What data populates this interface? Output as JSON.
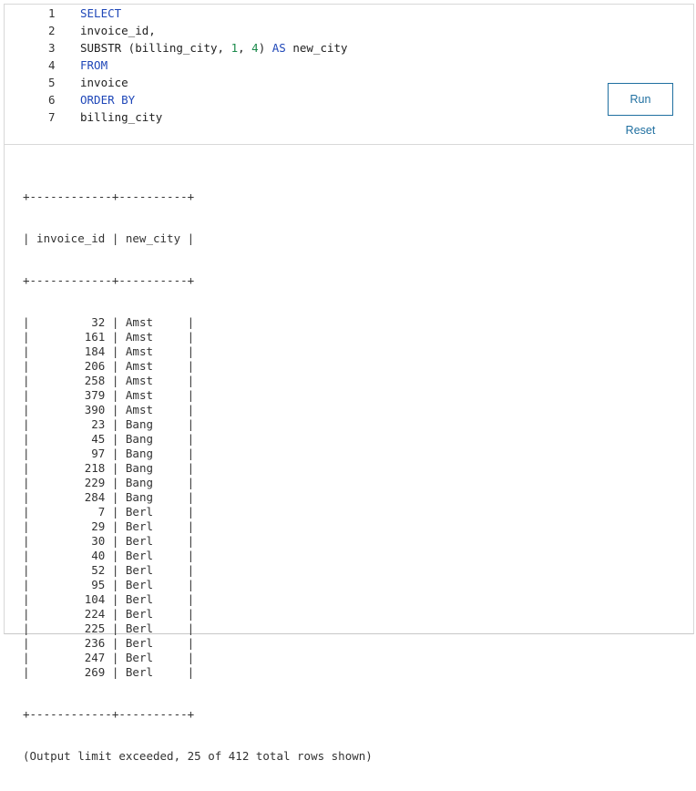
{
  "editor": {
    "lines": [
      {
        "num": "1",
        "parts": [
          {
            "t": "SELECT",
            "c": "kw"
          }
        ]
      },
      {
        "num": "2",
        "parts": [
          {
            "t": "invoice_id,",
            "c": ""
          }
        ]
      },
      {
        "num": "3",
        "parts": [
          {
            "t": "SUBSTR (billing_city, ",
            "c": ""
          },
          {
            "t": "1",
            "c": "num"
          },
          {
            "t": ", ",
            "c": ""
          },
          {
            "t": "4",
            "c": "num"
          },
          {
            "t": ") ",
            "c": ""
          },
          {
            "t": "AS",
            "c": "kw"
          },
          {
            "t": " new_city",
            "c": ""
          }
        ]
      },
      {
        "num": "4",
        "parts": [
          {
            "t": "FROM",
            "c": "kw"
          }
        ]
      },
      {
        "num": "5",
        "parts": [
          {
            "t": "invoice",
            "c": ""
          }
        ]
      },
      {
        "num": "6",
        "parts": [
          {
            "t": "ORDER BY",
            "c": "kw"
          }
        ]
      },
      {
        "num": "7",
        "parts": [
          {
            "t": "billing_city",
            "c": ""
          }
        ]
      }
    ]
  },
  "controls": {
    "run_label": "Run",
    "reset_label": "Reset"
  },
  "output": {
    "border": "+------------+----------+",
    "header": "| invoice_id | new_city |",
    "rows": [
      {
        "id": "32",
        "city": "Amst"
      },
      {
        "id": "161",
        "city": "Amst"
      },
      {
        "id": "184",
        "city": "Amst"
      },
      {
        "id": "206",
        "city": "Amst"
      },
      {
        "id": "258",
        "city": "Amst"
      },
      {
        "id": "379",
        "city": "Amst"
      },
      {
        "id": "390",
        "city": "Amst"
      },
      {
        "id": "23",
        "city": "Bang"
      },
      {
        "id": "45",
        "city": "Bang"
      },
      {
        "id": "97",
        "city": "Bang"
      },
      {
        "id": "218",
        "city": "Bang"
      },
      {
        "id": "229",
        "city": "Bang"
      },
      {
        "id": "284",
        "city": "Bang"
      },
      {
        "id": "7",
        "city": "Berl"
      },
      {
        "id": "29",
        "city": "Berl"
      },
      {
        "id": "30",
        "city": "Berl"
      },
      {
        "id": "40",
        "city": "Berl"
      },
      {
        "id": "52",
        "city": "Berl"
      },
      {
        "id": "95",
        "city": "Berl"
      },
      {
        "id": "104",
        "city": "Berl"
      },
      {
        "id": "224",
        "city": "Berl"
      },
      {
        "id": "225",
        "city": "Berl"
      },
      {
        "id": "236",
        "city": "Berl"
      },
      {
        "id": "247",
        "city": "Berl"
      },
      {
        "id": "269",
        "city": "Berl"
      }
    ],
    "footer_note": "(Output limit exceeded, 25 of 412 total rows shown)"
  }
}
